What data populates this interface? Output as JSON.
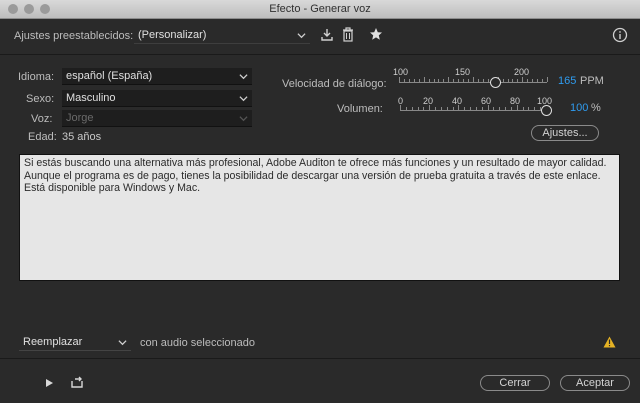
{
  "window": {
    "title": "Efecto - Generar voz"
  },
  "presets": {
    "label": "Ajustes preestablecidos:",
    "value": "(Personalizar)"
  },
  "voice": {
    "language_label": "Idioma:",
    "language_value": "español (España)",
    "sex_label": "Sexo:",
    "sex_value": "Masculino",
    "voice_label": "Voz:",
    "voice_value": "Jorge",
    "age_label": "Edad:",
    "age_value": "35 años"
  },
  "speech_rate": {
    "label": "Velocidad de diálogo:",
    "ticks": [
      "100",
      "150",
      "200"
    ],
    "value": "165",
    "unit": "PPM",
    "level": 0.65
  },
  "volume": {
    "label": "Volumen:",
    "ticks": [
      "0",
      "20",
      "40",
      "60",
      "80",
      "100"
    ],
    "value": "100",
    "unit": "%",
    "level": 1.0
  },
  "settings_button": "Ajustes...",
  "text_content": "Si estás buscando una alternativa más profesional, Adobe Auditon te ofrece más funciones y un resultado de mayor calidad. Aunque el programa es de pago, tienes la posibilidad de descargar una versión de prueba gratuita a través de este enlace. Está disponible para Windows y Mac.",
  "insert_mode": {
    "value": "Reemplazar",
    "suffix": "con audio seleccionado"
  },
  "footer": {
    "close_label": "Cerrar",
    "accept_label": "Aceptar"
  },
  "colors": {
    "accent": "#2f9cf0",
    "warning": "#e5b224",
    "background": "#2a2a2a"
  },
  "icons": [
    "save-preset-icon",
    "delete-icon",
    "star-icon",
    "info-icon",
    "warning-icon",
    "play-icon",
    "loop-icon"
  ]
}
